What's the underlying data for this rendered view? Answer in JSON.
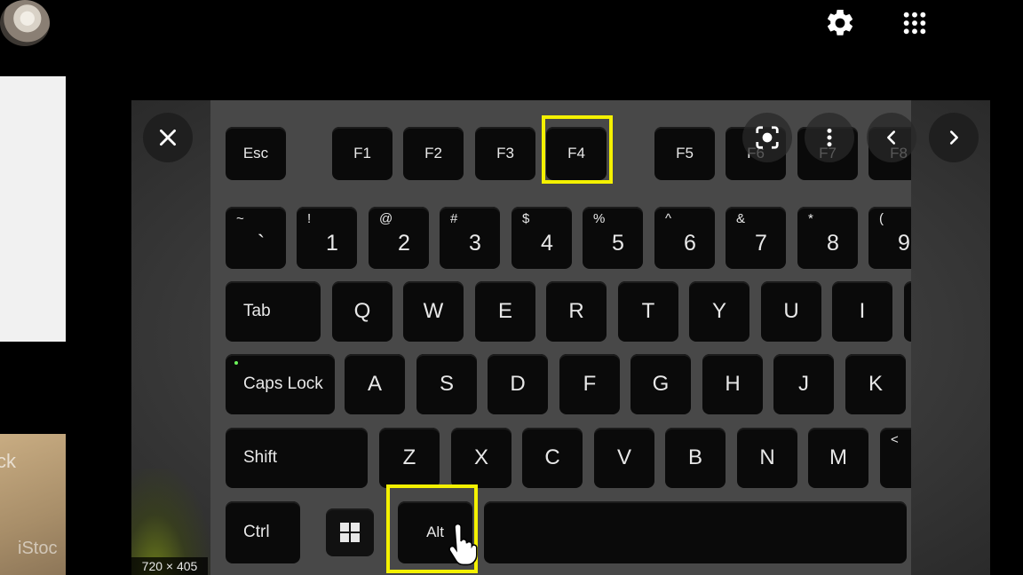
{
  "top_bar": {
    "settings_icon": "gear-icon",
    "apps_icon": "grid-icon",
    "avatar_icon": "profile-avatar"
  },
  "sidebar_thumb": {
    "watermark_partial": "ck",
    "watermark_brand": "iStoc"
  },
  "viewer": {
    "image_dimensions": "720 × 405",
    "controls": {
      "close_icon": "close-icon",
      "lens_icon": "lens-icon",
      "more_icon": "more-vert-icon",
      "prev_icon": "chevron-left-icon",
      "next_icon": "chevron-right-icon"
    },
    "highlight_color": "#f4f100"
  },
  "keyboard": {
    "function_row": {
      "esc": "Esc",
      "f1": "F1",
      "f2": "F2",
      "f3": "F3",
      "f4": "F4",
      "f5": "F5",
      "f6": "F6",
      "f7": "F7",
      "f8": "F8"
    },
    "number_row": [
      {
        "symbol": "~",
        "digit": "`"
      },
      {
        "symbol": "!",
        "digit": "1"
      },
      {
        "symbol": "@",
        "digit": "2"
      },
      {
        "symbol": "#",
        "digit": "3"
      },
      {
        "symbol": "$",
        "digit": "4"
      },
      {
        "symbol": "%",
        "digit": "5"
      },
      {
        "symbol": "^",
        "digit": "6"
      },
      {
        "symbol": "&",
        "digit": "7"
      },
      {
        "symbol": "*",
        "digit": "8"
      },
      {
        "symbol": "(",
        "digit": "9"
      }
    ],
    "top_row": {
      "tab": "Tab",
      "letters": [
        "Q",
        "W",
        "E",
        "R",
        "T",
        "Y",
        "U",
        "I"
      ]
    },
    "home_row": {
      "caps": "Caps Lock",
      "letters": [
        "A",
        "S",
        "D",
        "F",
        "G",
        "H",
        "J",
        "K"
      ]
    },
    "bottom_row": {
      "shift": "Shift",
      "letters": [
        "Z",
        "X",
        "C",
        "V",
        "B",
        "N",
        "M"
      ],
      "comma_symbol": "<"
    },
    "space_row": {
      "ctrl": "Ctrl",
      "win_icon": "windows-logo-icon",
      "alt": "Alt"
    }
  },
  "cursor_icon": "hand-pointer-icon"
}
